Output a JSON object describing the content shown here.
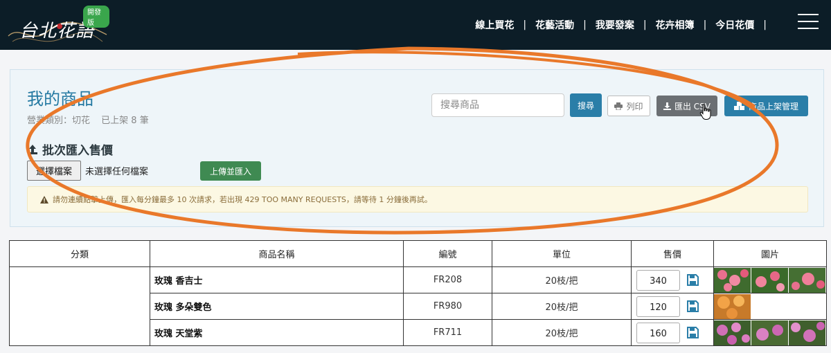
{
  "header": {
    "logo_text": "台北花語",
    "logo_badge": "開發版",
    "nav": [
      "線上買花",
      "花藝活動",
      "我要發案",
      "花卉相簿",
      "今日花價"
    ],
    "nav_separator": "|"
  },
  "panel": {
    "title": "我的商品",
    "category_label": "營業類別：切花",
    "listed_count": "已上架 8 筆",
    "search": {
      "placeholder": "搜尋商品",
      "button": "搜尋"
    },
    "print_button": "列印",
    "csv_button": "匯出 CSV",
    "manage_button": "商品上架管理",
    "batch_title": "批次匯入售價",
    "file_button": "選擇檔案",
    "file_status": "未選擇任何檔案",
    "upload_button": "上傳並匯入",
    "warning": "請勿連續點擊上傳，匯入每分鐘最多 10 次請求，若出現 429 TOO MANY REQUESTS，請等待 1 分鐘後再試。"
  },
  "table": {
    "headers": [
      "分類",
      "商品名稱",
      "編號",
      "單位",
      "售價",
      "圖片"
    ],
    "rows": [
      {
        "category": "",
        "name": "玫瑰 香吉士",
        "code": "FR208",
        "unit": "20枝/把",
        "price": "340",
        "images": [
          "pink",
          "pink",
          "pink"
        ]
      },
      {
        "category": "",
        "name": "玫瑰 多朵雙色",
        "code": "FR980",
        "unit": "20枝/把",
        "price": "120",
        "images": [
          "orange"
        ]
      },
      {
        "category": "",
        "name": "玫瑰 天堂紫",
        "code": "FR711",
        "unit": "20枝/把",
        "price": "160",
        "images": [
          "violet",
          "violet",
          "violet"
        ]
      }
    ]
  },
  "colors": {
    "header_bg": "#0c1d27",
    "accent": "#2a7ea8",
    "annotation": "#e9782a"
  }
}
